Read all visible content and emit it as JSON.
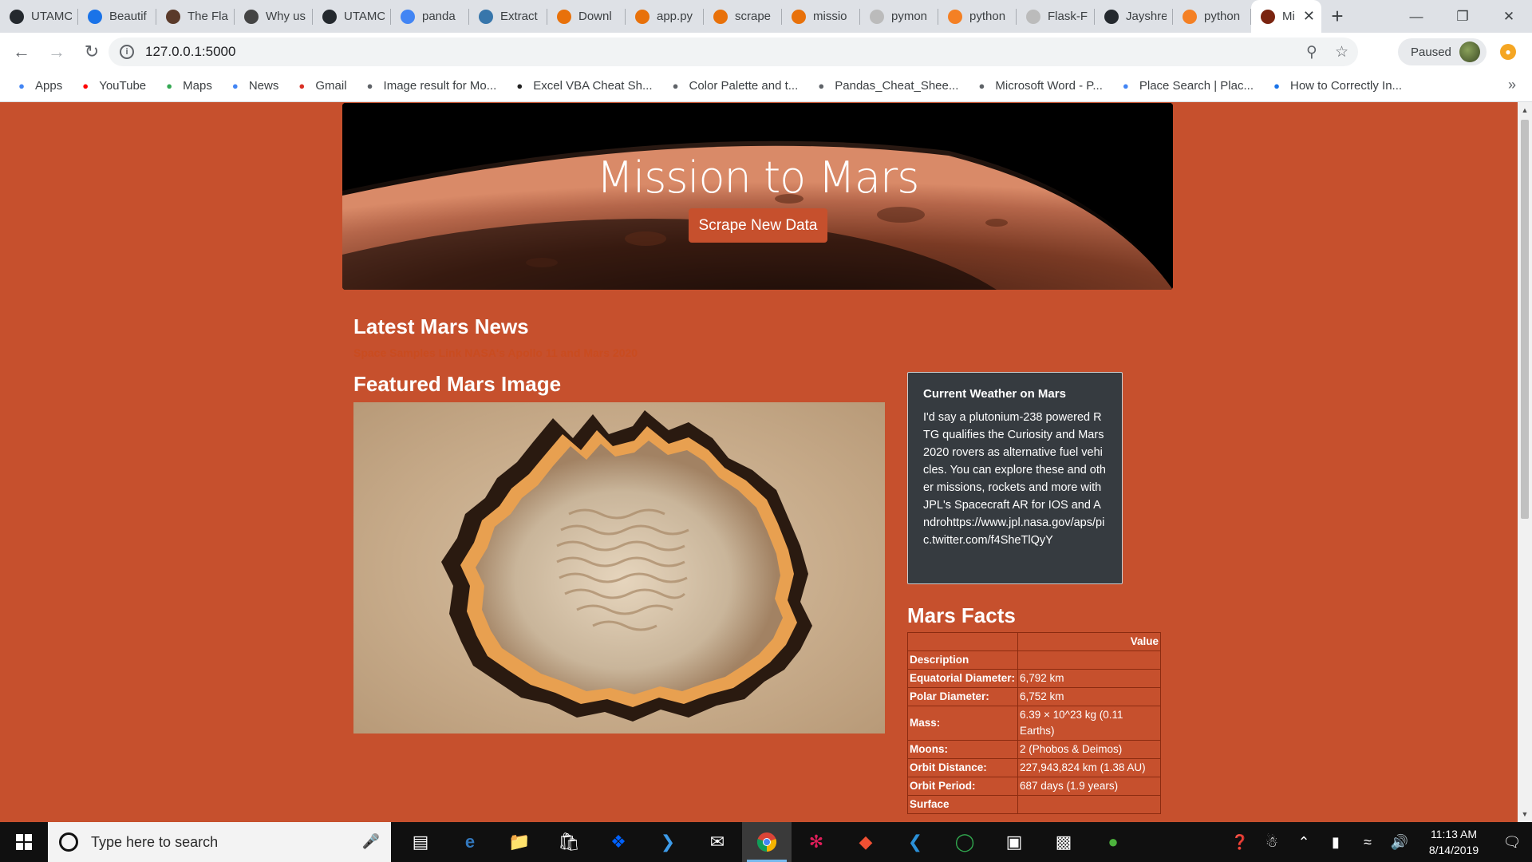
{
  "tabs": [
    {
      "title": "UTAMC",
      "favicon": "github-icon",
      "color": "#24292e"
    },
    {
      "title": "Beautif",
      "favicon": "c-icon",
      "color": "#1a73e8"
    },
    {
      "title": "The Fla",
      "favicon": "portrait-icon",
      "color": "#5a3a2a"
    },
    {
      "title": "Why us",
      "favicon": "page-icon",
      "color": "#444"
    },
    {
      "title": "UTAMC",
      "favicon": "github-icon",
      "color": "#24292e"
    },
    {
      "title": "panda",
      "favicon": "google-icon",
      "color": "#4285f4"
    },
    {
      "title": "Extract",
      "favicon": "python-icon",
      "color": "#3776ab"
    },
    {
      "title": "Downl",
      "favicon": "loader-icon",
      "color": "#e8710a"
    },
    {
      "title": "app.py",
      "favicon": "file-icon",
      "color": "#e8710a"
    },
    {
      "title": "scrape",
      "favicon": "file-icon",
      "color": "#e8710a"
    },
    {
      "title": "missio",
      "favicon": "notebook-icon",
      "color": "#e8710a"
    },
    {
      "title": "pymon",
      "favicon": "cube-icon",
      "color": "#bbb"
    },
    {
      "title": "python",
      "favicon": "stackoverflow-icon",
      "color": "#f48024"
    },
    {
      "title": "Flask-F",
      "favicon": "cube-icon",
      "color": "#bbb"
    },
    {
      "title": "Jayshre",
      "favicon": "github-icon",
      "color": "#24292e"
    },
    {
      "title": "python",
      "favicon": "stackoverflow-icon",
      "color": "#f48024"
    },
    {
      "title": "Mi",
      "favicon": "mars-icon",
      "color": "#7a2410",
      "active": true
    }
  ],
  "toolbar": {
    "url": "127.0.0.1:5000",
    "profile_label": "Paused"
  },
  "bookmarks": [
    {
      "label": "Apps",
      "icon": "apps-grid-icon",
      "color": "#4285f4"
    },
    {
      "label": "YouTube",
      "icon": "youtube-icon",
      "color": "#ff0000"
    },
    {
      "label": "Maps",
      "icon": "maps-icon",
      "color": "#34a853"
    },
    {
      "label": "News",
      "icon": "news-icon",
      "color": "#4285f4"
    },
    {
      "label": "Gmail",
      "icon": "gmail-icon",
      "color": "#d93025"
    },
    {
      "label": "Image result for Mo...",
      "icon": "globe-icon",
      "color": "#5f6368"
    },
    {
      "label": "Excel VBA Cheat Sh...",
      "icon": "person-icon",
      "color": "#222"
    },
    {
      "label": "Color Palette and t...",
      "icon": "globe-icon",
      "color": "#5f6368"
    },
    {
      "label": "Pandas_Cheat_Shee...",
      "icon": "globe-icon",
      "color": "#5f6368"
    },
    {
      "label": "Microsoft Word - P...",
      "icon": "globe-icon",
      "color": "#5f6368"
    },
    {
      "label": "Place Search  |  Plac...",
      "icon": "code-icon",
      "color": "#4285f4"
    },
    {
      "label": "How to Correctly In...",
      "icon": "flag-icon",
      "color": "#1a73e8"
    }
  ],
  "page": {
    "title": "Mission to Mars",
    "scrape_button": "Scrape New Data",
    "news_heading": "Latest Mars News",
    "news_title": "Space Samples Link NASA's Apollo 11 and Mars 2020",
    "featured_heading": "Featured Mars Image",
    "weather_title": "Current Weather on Mars",
    "weather_body": "I'd say a plutonium-238 powered RTG qualifies the Curiosity and Mars2020 rovers as alternative fuel vehicles. You can explore these and other missions, rockets and more with JPL's Spacecraft AR for IOS and Androhttps://www.jpl.nasa.gov/aps/pic.twitter.com/f4SheTlQyY",
    "facts_heading": "Mars Facts",
    "facts_header_value": "Value",
    "facts_header_desc": "Description",
    "facts": [
      {
        "label": "Equatorial Diameter:",
        "value": "6,792 km"
      },
      {
        "label": "Polar Diameter:",
        "value": "6,752 km"
      },
      {
        "label": "Mass:",
        "value": "6.39 × 10^23 kg (0.11 Earths)"
      },
      {
        "label": "Moons:",
        "value": "2 (Phobos & Deimos)"
      },
      {
        "label": "Orbit Distance:",
        "value": "227,943,824 km (1.38 AU)"
      },
      {
        "label": "Orbit Period:",
        "value": "687 days (1.9 years)"
      },
      {
        "label": "Surface",
        "value": ""
      }
    ]
  },
  "taskbar": {
    "search_placeholder": "Type here to search",
    "time": "11:13 AM",
    "date": "8/14/2019"
  },
  "colors": {
    "page_bg": "#c6502d",
    "weather_bg": "#363b40"
  }
}
